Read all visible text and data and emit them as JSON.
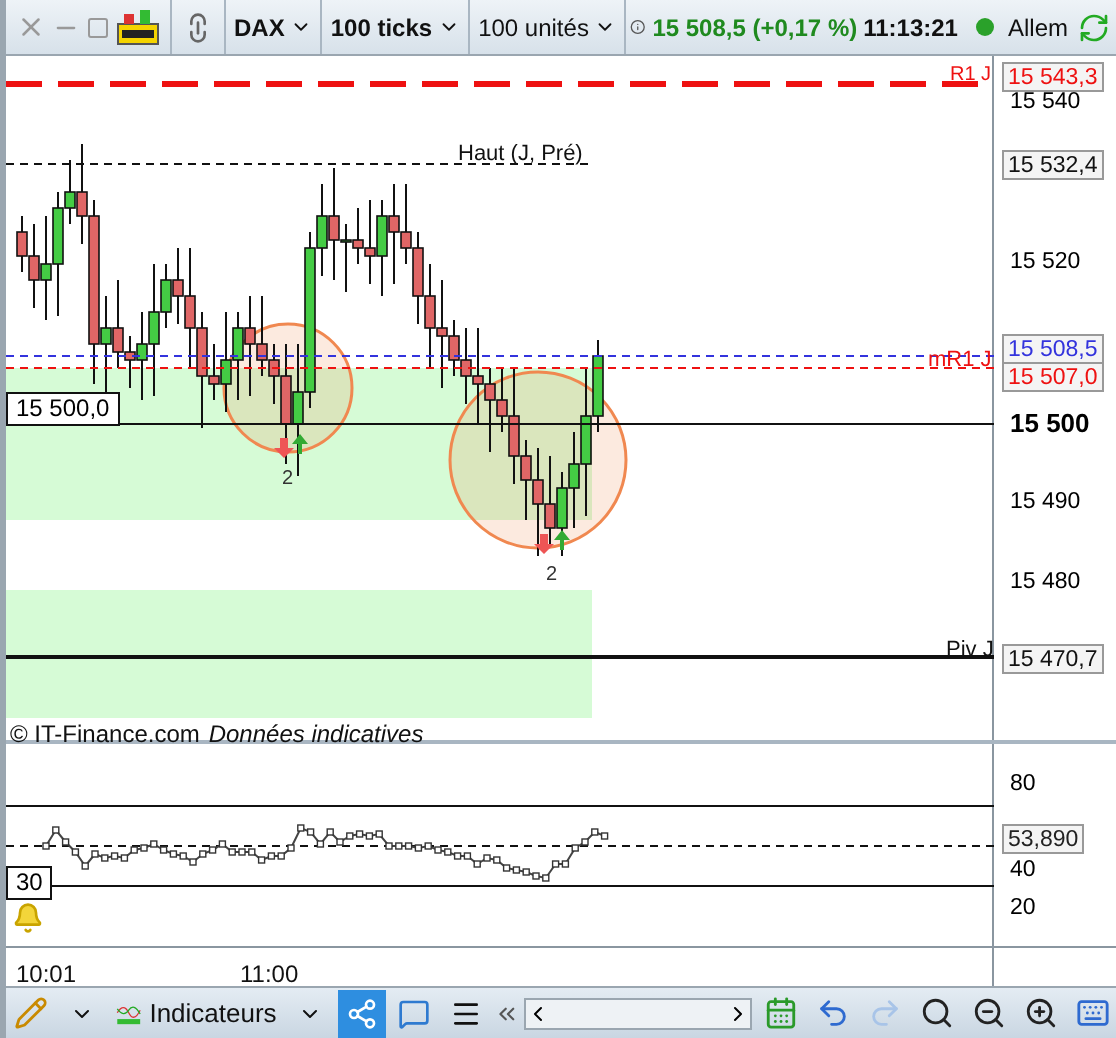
{
  "toolbar": {
    "symbol": "DAX",
    "period": "100 ticks",
    "units": "100 unités",
    "price": "15 508,5 (+0,17 %)",
    "time": "11:13:21",
    "market": "Allem",
    "market_open": true
  },
  "price_axis": {
    "ticks": [
      "15 540",
      "15 520",
      "15 500",
      "15 490",
      "15 480"
    ],
    "markers": [
      {
        "text": "15 543,3",
        "color": "#ee1111"
      },
      {
        "text": "15 532,4",
        "color": "#111111"
      },
      {
        "text": "15 508,5",
        "color": "#3333dd"
      },
      {
        "text": "15 507,0",
        "color": "#ee1111"
      },
      {
        "text": "15 470,7",
        "color": "#111111"
      }
    ]
  },
  "levels": [
    {
      "label": "R1 J",
      "color": "#ee1111"
    },
    {
      "label": "Haut (J, Pré)",
      "color": "#111111"
    },
    {
      "label": "mR1 J",
      "color": "#ee1111"
    },
    {
      "label": "Piv J",
      "color": "#111111"
    }
  ],
  "price_box": "15 500,0",
  "signals": [
    "2",
    "2"
  ],
  "credit": "© IT-Finance.com",
  "note": "Données indicatives",
  "rsi": {
    "ticks": [
      "80",
      "40",
      "20"
    ],
    "value": "53,890",
    "threshold": "30"
  },
  "time_axis": [
    "10:01",
    "11:00"
  ],
  "bottom_toolbar": {
    "indicators": "Indicateurs",
    "redo_disabled": true
  }
}
